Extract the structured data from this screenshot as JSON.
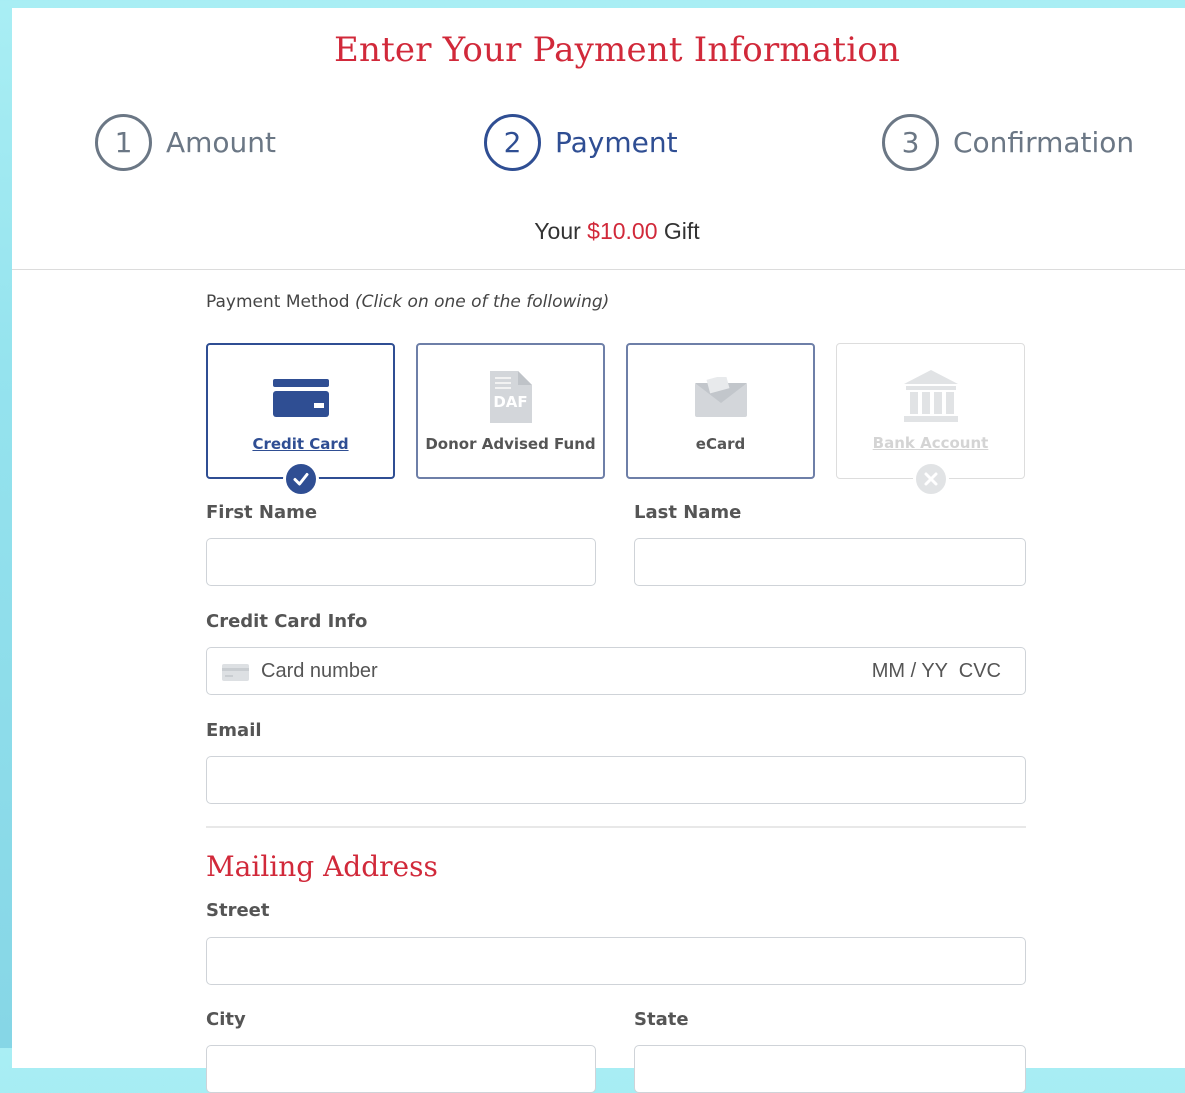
{
  "page": {
    "title": "Enter Your Payment Information",
    "steps": [
      {
        "number": "1",
        "label": "Amount",
        "active": false
      },
      {
        "number": "2",
        "label": "Payment",
        "active": true
      },
      {
        "number": "3",
        "label": "Confirmation",
        "active": false
      }
    ],
    "gift": {
      "prefix": "Your",
      "amount": "$10.00",
      "suffix": "Gift"
    }
  },
  "payment_method": {
    "label": "Payment Method",
    "hint": "(Click on one of the following)",
    "options": [
      {
        "label": "Credit Card",
        "icon": "credit-card-icon",
        "state": "selected"
      },
      {
        "label": "Donor Advised Fund",
        "icon": "daf-document-icon",
        "icon_text": "DAF",
        "state": "available"
      },
      {
        "label": "eCard",
        "icon": "envelope-icon",
        "state": "available"
      },
      {
        "label": "Bank Account",
        "icon": "bank-icon",
        "state": "disabled"
      }
    ]
  },
  "form": {
    "first_name_label": "First Name",
    "last_name_label": "Last Name",
    "credit_card_label": "Credit Card Info",
    "card_number_placeholder": "Card number",
    "card_expiry_cvc_placeholder": "MM / YY  CVC",
    "email_label": "Email",
    "mailing_address_heading": "Mailing Address",
    "street_label": "Street",
    "city_label": "City",
    "state_label": "State"
  },
  "colors": {
    "accent_red": "#d1293a",
    "primary_blue": "#2f4e93",
    "muted_gray": "#6b7785"
  }
}
